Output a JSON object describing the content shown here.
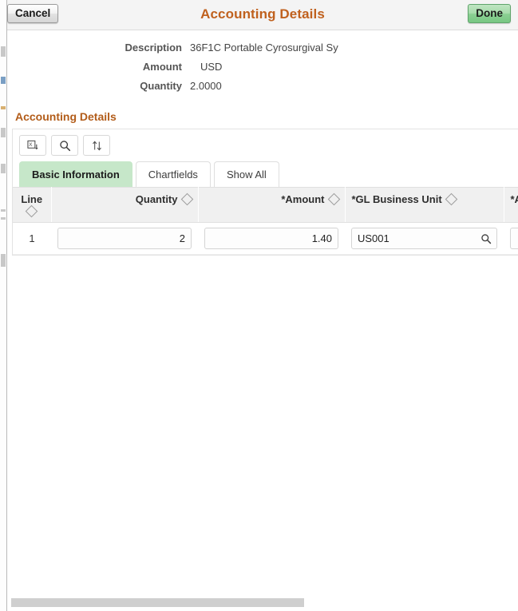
{
  "window": {
    "title": "Accounting Details"
  },
  "header": {
    "cancel_label": "Cancel",
    "done_label": "Done",
    "title": "Accounting Details",
    "title_color": "#c0611e",
    "done_color": "#8bd093"
  },
  "info": {
    "rows": [
      {
        "label": "Description",
        "value": "36F1C Portable Cyrosurgival Sy"
      },
      {
        "label": "Amount",
        "value": "USD"
      },
      {
        "label": "Quantity",
        "value": "2.0000"
      }
    ]
  },
  "section": {
    "title": "Accounting Details",
    "title_color": "#b25c19"
  },
  "toolbar": {
    "buttons": [
      {
        "name": "download-to-excel-icon",
        "title": "Download to Excel"
      },
      {
        "name": "search-icon",
        "title": "Find"
      },
      {
        "name": "sort-icon",
        "title": "Sort"
      }
    ]
  },
  "tabs": [
    {
      "label": "Basic Information",
      "active": true
    },
    {
      "label": "Chartfields",
      "active": false
    },
    {
      "label": "Show All",
      "active": false
    }
  ],
  "grid": {
    "columns": [
      {
        "key": "line",
        "label": "Line",
        "sortable": true,
        "align": "center"
      },
      {
        "key": "quantity",
        "label": "Quantity",
        "sortable": true,
        "align": "right"
      },
      {
        "key": "amount",
        "label": "*Amount",
        "sortable": true,
        "align": "right"
      },
      {
        "key": "gl_business_unit",
        "label": "*GL Business Unit",
        "sortable": true,
        "align": "left"
      },
      {
        "key": "account",
        "label": "*A",
        "sortable": false,
        "align": "left"
      }
    ],
    "rows": [
      {
        "line": "1",
        "quantity": "2",
        "amount": "1.40",
        "gl_business_unit": "US001",
        "account": ""
      }
    ]
  },
  "scrollbar": {
    "orientation": "horizontal",
    "thumb_color": "#cfcfcf"
  }
}
